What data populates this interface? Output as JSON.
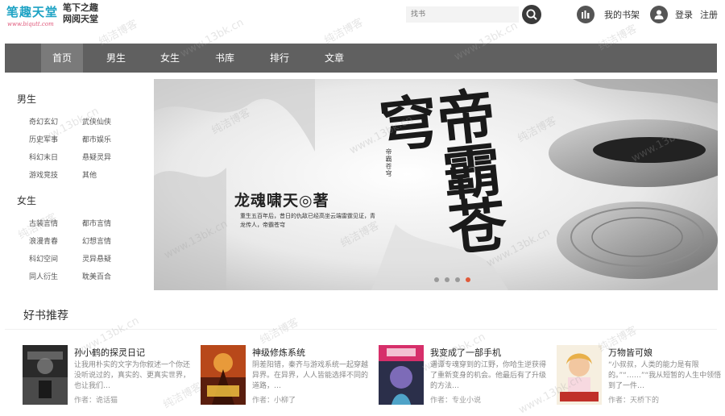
{
  "header": {
    "logo_main": "笔趣天堂",
    "logo_sub": "www.biqutt.com",
    "slogan_line1": "笔下之趣",
    "slogan_line2": "网阅天堂",
    "search_placeholder": "找书",
    "bookshelf_label": "我的书架",
    "login_label": "登录",
    "register_label": "注册"
  },
  "nav": {
    "items": [
      {
        "label": "首页",
        "active": true
      },
      {
        "label": "男生"
      },
      {
        "label": "女生"
      },
      {
        "label": "书库"
      },
      {
        "label": "排行"
      },
      {
        "label": "文章"
      }
    ]
  },
  "sidebar": {
    "male": {
      "title": "男生",
      "links": [
        "奇幻玄幻",
        "武侠仙侠",
        "历史军事",
        "都市娱乐",
        "科幻末日",
        "悬疑灵异",
        "游戏竞技",
        "其他"
      ]
    },
    "female": {
      "title": "女生",
      "links": [
        "古装言情",
        "都市言情",
        "浪漫青春",
        "幻想言情",
        "科幻空间",
        "灵异悬疑",
        "同人衍生",
        "耽美百合"
      ]
    }
  },
  "banner": {
    "author_line": "龙魂啸天◎著",
    "description": "重生五百年后，昔日的仇敌已经高坐云端雷霆见证，青龙传人，帝霸苍穹",
    "title": "帝霸苍穹",
    "series_text": "帝霸苍穹",
    "active_dot": 3,
    "dot_count": 4
  },
  "recommend": {
    "title": "好书推荐",
    "books": [
      {
        "title": "孙小鹤的探灵日记",
        "description": "让我用朴实的文字为你叙述一个你还没听说过的，真实的、更真实世界，也让我们…",
        "author": "作者：诡话猫"
      },
      {
        "title": "神级修炼系统",
        "description": "阴差阳错，秦齐与游戏系统一起穿越异界。在异界，人人皆能选择不同的道路，…",
        "author": "作者：小柳了"
      },
      {
        "title": "我变成了一部手机",
        "description": "遇谭专魂穿到的江野，你哈生逆获得了重新变身的机会。他最后有了升级的方法…",
        "author": "作者：专业小说"
      },
      {
        "title": "万物皆可娘",
        "description": "“小叔叔，人类的能力是有限的。”“……”“我从短暂的人生中领悟到了一件…",
        "author": "作者：天桥下的"
      }
    ]
  },
  "watermark_text": "纯洁博客",
  "watermark_url": "www.13bk.cn"
}
